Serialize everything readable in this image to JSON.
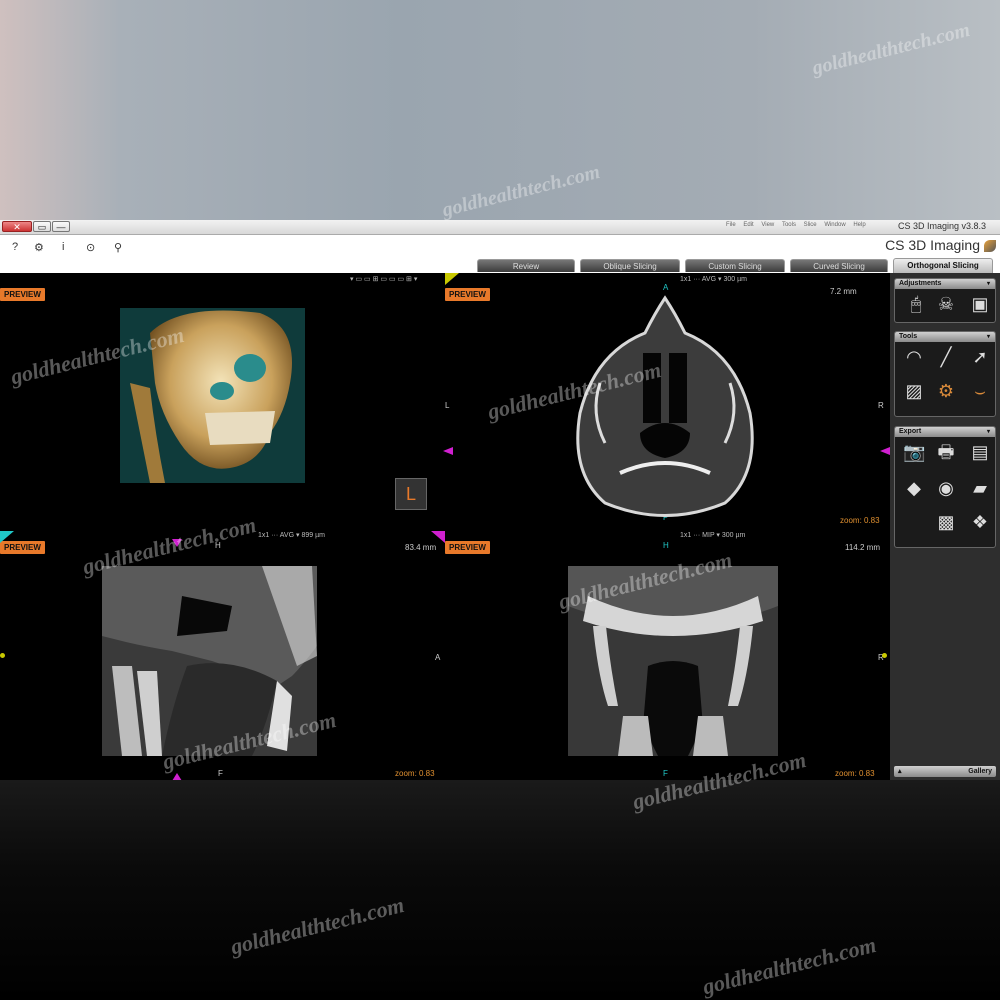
{
  "window": {
    "title": "CS 3D Imaging v3.8.3",
    "menu_items": [
      "File",
      "Edit",
      "View",
      "Tools",
      "Slice",
      "Window",
      "Help"
    ],
    "buttons": {
      "close": "✕",
      "restore": "▭",
      "minimize": "—"
    }
  },
  "toolbar": {
    "app_name": "CS 3D Imaging",
    "icons": [
      "help-icon",
      "settings-icon",
      "info-icon",
      "target-icon",
      "user-icon"
    ],
    "icon_glyphs": {
      "help": "?",
      "settings": "⚙",
      "info": "i",
      "target": "⊙",
      "user": "⚲"
    }
  },
  "tabs": [
    {
      "label": "Orthogonal Slicing",
      "active": true
    },
    {
      "label": "Curved Slicing",
      "active": false
    },
    {
      "label": "Custom Slicing",
      "active": false
    },
    {
      "label": "Oblique Slicing",
      "active": false
    },
    {
      "label": "Review",
      "active": false
    }
  ],
  "viewports": {
    "volume": {
      "badge": "PREVIEW",
      "orientation_box": "L"
    },
    "axial": {
      "badge": "PREVIEW",
      "thickness": "7.2 mm",
      "controls": "1x1   ···   AVG ▾   300 µm",
      "top_marker": "A",
      "bottom_marker": "P",
      "left_label": "L",
      "right_label": "R",
      "zoom": "zoom: 0.83"
    },
    "sagittal": {
      "badge": "PREVIEW",
      "thickness": "83.4 mm",
      "controls": "1x1   ···   AVG ▾   899 µm",
      "top_marker": "H",
      "bottom_marker": "F",
      "right_label": "A",
      "zoom": "zoom: 0.83"
    },
    "coronal": {
      "badge": "PREVIEW",
      "thickness": "114.2 mm",
      "controls": "1x1   ···   MIP ▾   300 µm",
      "top_marker": "H",
      "bottom_marker": "F",
      "right_label": "R",
      "zoom": "zoom: 0.83"
    }
  },
  "sidebar": {
    "adjustments": {
      "title": "Adjustments"
    },
    "tools": {
      "title": "Tools"
    },
    "export": {
      "title": "Export"
    },
    "gallery": {
      "title": "Gallery"
    }
  },
  "watermark": "goldhealthtech.com",
  "colors": {
    "accent": "#e8792a",
    "marker_magenta": "#d020d0",
    "marker_cyan": "#20c8c8",
    "marker_yellow": "#c8c800"
  }
}
